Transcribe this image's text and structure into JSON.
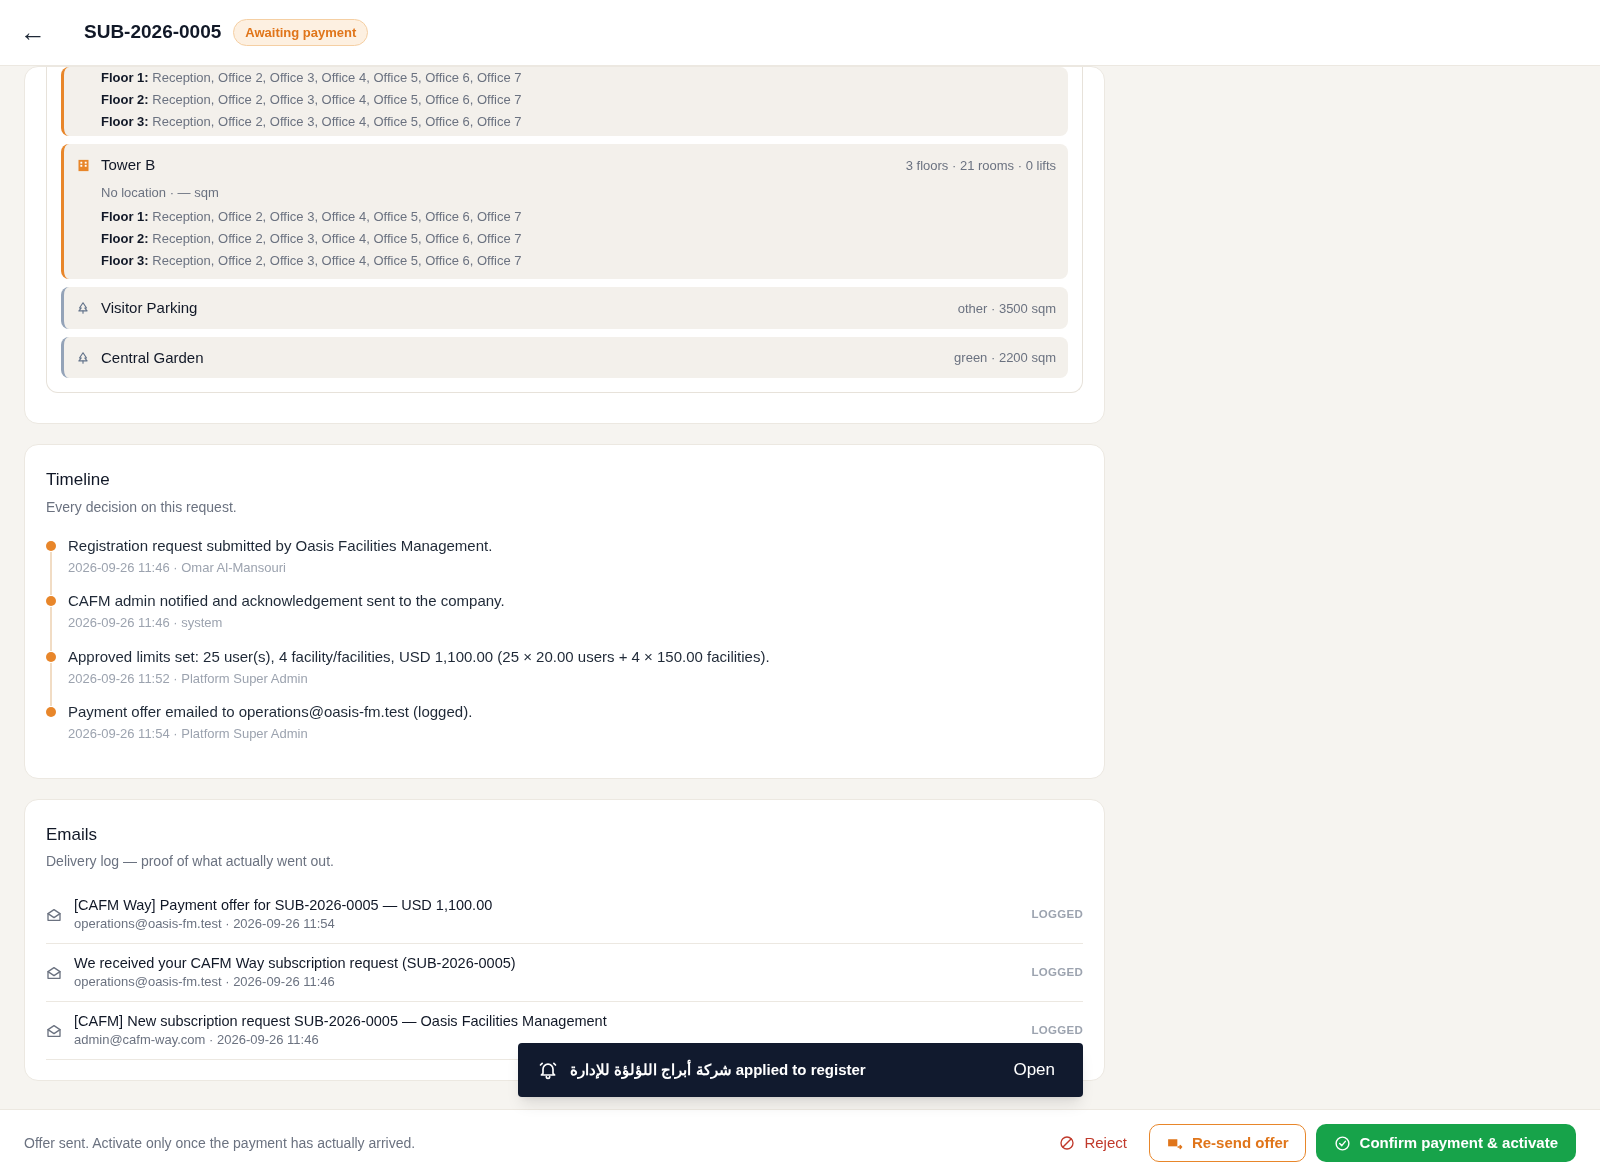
{
  "header": {
    "back": "←",
    "title": "SUB-2026-0005",
    "status": "Awaiting payment"
  },
  "facilities": [
    {
      "kind": "building",
      "floors": [
        {
          "label": "Floor 1:",
          "rooms": "Reception, Office 2, Office 3, Office 4, Office 5, Office 6, Office 7"
        },
        {
          "label": "Floor 2:",
          "rooms": "Reception, Office 2, Office 3, Office 4, Office 5, Office 6, Office 7"
        },
        {
          "label": "Floor 3:",
          "rooms": "Reception, Office 2, Office 3, Office 4, Office 5, Office 6, Office 7"
        }
      ]
    },
    {
      "kind": "building",
      "name": "Tower B",
      "summary": "3 floors · 21 rooms · 0 lifts",
      "details": "No location · — sqm",
      "floors": [
        {
          "label": "Floor 1:",
          "rooms": "Reception, Office 2, Office 3, Office 4, Office 5, Office 6, Office 7"
        },
        {
          "label": "Floor 2:",
          "rooms": "Reception, Office 2, Office 3, Office 4, Office 5, Office 6, Office 7"
        },
        {
          "label": "Floor 3:",
          "rooms": "Reception, Office 2, Office 3, Office 4, Office 5, Office 6, Office 7"
        }
      ]
    },
    {
      "kind": "area",
      "name": "Visitor Parking",
      "summary": "other · 3500 sqm"
    },
    {
      "kind": "area",
      "name": "Central Garden",
      "summary": "green · 2200 sqm"
    }
  ],
  "timeline": {
    "title": "Timeline",
    "subtitle": "Every decision on this request.",
    "events": [
      {
        "text": "Registration request submitted by Oasis Facilities Management.",
        "meta": "2026-09-26 11:46 · Omar Al-Mansouri"
      },
      {
        "text": "CAFM admin notified and acknowledgement sent to the company.",
        "meta": "2026-09-26 11:46 · system"
      },
      {
        "text": "Approved limits set: 25 user(s), 4 facility/facilities, USD 1,100.00 (25 × 20.00 users + 4 × 150.00 facilities).",
        "meta": "2026-09-26 11:52 · Platform Super Admin"
      },
      {
        "text": "Payment offer emailed to operations@oasis-fm.test (logged).",
        "meta": "2026-09-26 11:54 · Platform Super Admin"
      }
    ]
  },
  "emails": {
    "title": "Emails",
    "subtitle": "Delivery log — proof of what actually went out.",
    "rows": [
      {
        "subject": "[CAFM Way] Payment offer for SUB-2026-0005 — USD 1,100.00",
        "meta": "operations@oasis-fm.test · 2026-09-26 11:54",
        "status": "LOGGED"
      },
      {
        "subject": "We received your CAFM Way subscription request (SUB-2026-0005)",
        "meta": "operations@oasis-fm.test · 2026-09-26 11:46",
        "status": "LOGGED"
      },
      {
        "subject": "[CAFM] New subscription request SUB-2026-0005 — Oasis Facilities Management",
        "meta": "admin@cafm-way.com · 2026-09-26 11:46",
        "status": "LOGGED"
      }
    ]
  },
  "toast": {
    "message": "شركة أبراج اللؤلؤة للإدارة applied to register",
    "action": "Open"
  },
  "footer": {
    "note": "Offer sent. Activate only once the payment has actually arrived.",
    "buttons": [
      {
        "kind": "danger",
        "label": "Reject"
      },
      {
        "kind": "outline",
        "label": "Re-send offer"
      },
      {
        "kind": "primary",
        "label": "Confirm payment & activate"
      }
    ]
  }
}
